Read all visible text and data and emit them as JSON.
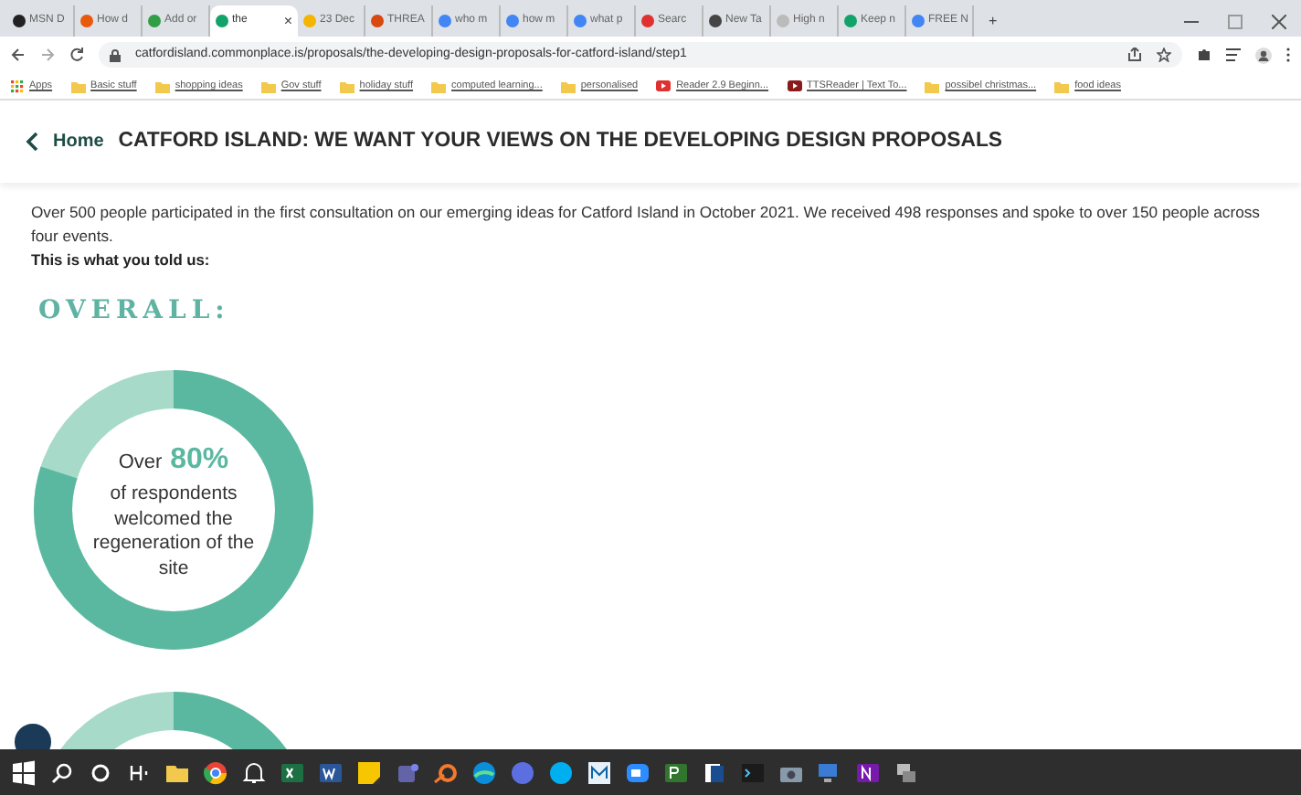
{
  "browser": {
    "tabs": [
      {
        "label": "MSN D",
        "selected": false,
        "color": "#222222"
      },
      {
        "label": "How d",
        "selected": false,
        "color": "#e8590c"
      },
      {
        "label": "Add or",
        "selected": false,
        "color": "#2f9e44"
      },
      {
        "label": "the",
        "selected": true,
        "color": "#12a36b"
      },
      {
        "label": "23 Dec",
        "selected": false,
        "color": "#f4b400"
      },
      {
        "label": "THREA",
        "selected": false,
        "color": "#d9480f"
      },
      {
        "label": "who m",
        "selected": false,
        "color": "#4285f4"
      },
      {
        "label": "how m",
        "selected": false,
        "color": "#4285f4"
      },
      {
        "label": "what p",
        "selected": false,
        "color": "#4285f4"
      },
      {
        "label": "Searc",
        "selected": false,
        "color": "#e03131"
      },
      {
        "label": "New Ta",
        "selected": false,
        "color": "#444444"
      },
      {
        "label": "High n",
        "selected": false,
        "color": "#bbbbbb"
      },
      {
        "label": "Keep n",
        "selected": false,
        "color": "#12a36b"
      },
      {
        "label": "FREE N",
        "selected": false,
        "color": "#4285f4"
      }
    ],
    "close_glyph": "×",
    "new_tab_glyph": "+",
    "url": "catfordisland.commonplace.is/proposals/the-developing-design-proposals-for-catford-island/step1",
    "bookmarks": [
      {
        "label": "Apps",
        "kind": "apps"
      },
      {
        "label": "Basic stuff",
        "kind": "folder"
      },
      {
        "label": "shopping ideas",
        "kind": "folder"
      },
      {
        "label": "Gov stuff",
        "kind": "folder"
      },
      {
        "label": "holiday stuff",
        "kind": "folder"
      },
      {
        "label": "computed learning...",
        "kind": "folder"
      },
      {
        "label": "personalised",
        "kind": "folder"
      },
      {
        "label": "Reader 2.9 Beginn...",
        "kind": "site",
        "color": "#e03131"
      },
      {
        "label": "TTSReader | Text To...",
        "kind": "site",
        "color": "#8b1a1a"
      },
      {
        "label": "possibel christmas...",
        "kind": "folder"
      },
      {
        "label": "food ideas",
        "kind": "folder"
      }
    ]
  },
  "page": {
    "home_link": "Home",
    "title": "CATFORD ISLAND: WE WANT YOUR VIEWS ON THE DEVELOPING DESIGN PROPOSALS",
    "intro": "Over 500 people participated in the first consultation on our emerging ideas for Catford Island in October 2021. We received 498 responses and spoke to over 150 people across four events.",
    "lead": "This is what you told us:",
    "section_heading": "OVERALL:",
    "donuts": [
      {
        "level": 0.8,
        "prefix": "Over",
        "percent": "80%",
        "caption": "of respondents welcomed the regeneration of the site"
      }
    ]
  }
}
